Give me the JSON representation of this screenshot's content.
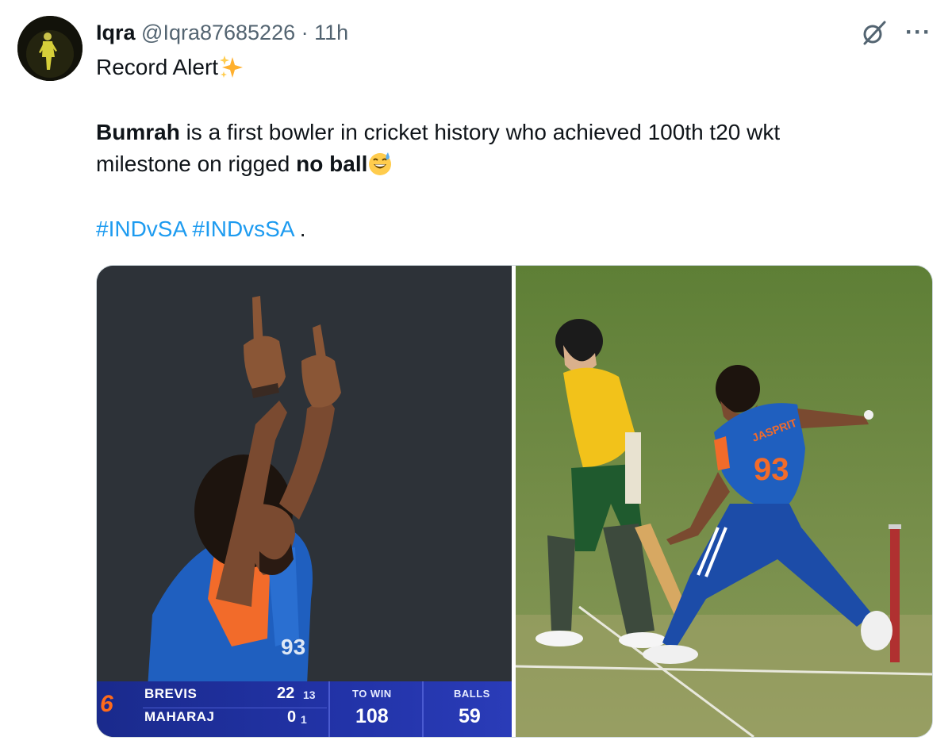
{
  "tweet": {
    "author_name": "Iqra",
    "author_handle": "@Iqra87685226",
    "separator": "·",
    "time": "11h",
    "line1": "Record Alert",
    "line2_bold": "Bumrah",
    "line2_rest": " is a first bowler in cricket history who achieved 100th t20 wkt",
    "line3_start": "milestone on rigged ",
    "line3_bold": "no ball",
    "hashtag1": "#INDvSA",
    "hashtag2": "#INDvsSA",
    "trailing": " ."
  },
  "icons": {
    "grok": "grok-icon",
    "more": "more-options-icon",
    "sparkles": "sparkles-emoji",
    "sweat_smile": "grinning-sweat-emoji"
  },
  "more_glyph": "···",
  "scoreboard": {
    "six": "6",
    "batter1": "BREVIS",
    "batter1_runs": "22",
    "batter1_balls": "13",
    "batter2": "MAHARAJ",
    "batter2_runs": "0",
    "batter2_balls": "1",
    "to_win_label": "TO WIN",
    "to_win": "108",
    "balls_label": "BALLS",
    "balls": "59"
  },
  "jersey": {
    "name": "JASPRIT",
    "number": "93"
  },
  "colors": {
    "hashtag": "#1d9bf0",
    "meta_grey": "#536471",
    "scoreboard_blue": "#2233a8",
    "india_blue": "#1f5fbf",
    "india_orange": "#f26b2a",
    "sa_yellow": "#f2c21a",
    "sa_green": "#1f5a2e",
    "pitch_green": "#6a8a40"
  }
}
